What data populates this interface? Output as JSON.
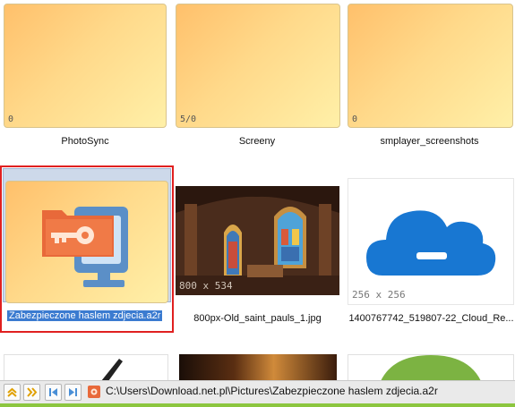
{
  "folders": [
    {
      "name": "PhotoSync",
      "count": "0"
    },
    {
      "name": "Screeny",
      "count": "5/0"
    },
    {
      "name": "smplayer_screenshots",
      "count": "0"
    }
  ],
  "files": [
    {
      "name": "Zabezpieczone haslem zdjecia.a2r",
      "dimensions": "",
      "selected": true
    },
    {
      "name": "800px-Old_saint_pauls_1.jpg",
      "dimensions": "800 x 534"
    },
    {
      "name": "1400767742_519807-22_Cloud_Re...",
      "dimensions": "256 x 256"
    }
  ],
  "status": {
    "path": "C:\\Users\\Download.net.pl\\Pictures\\Zabezpieczone haslem zdjecia.a2r"
  },
  "colors": {
    "selection": "#3b7bd0",
    "highlight_border": "#e02020",
    "cloud_blue": "#1877d2",
    "status_green": "#8cc63f"
  }
}
